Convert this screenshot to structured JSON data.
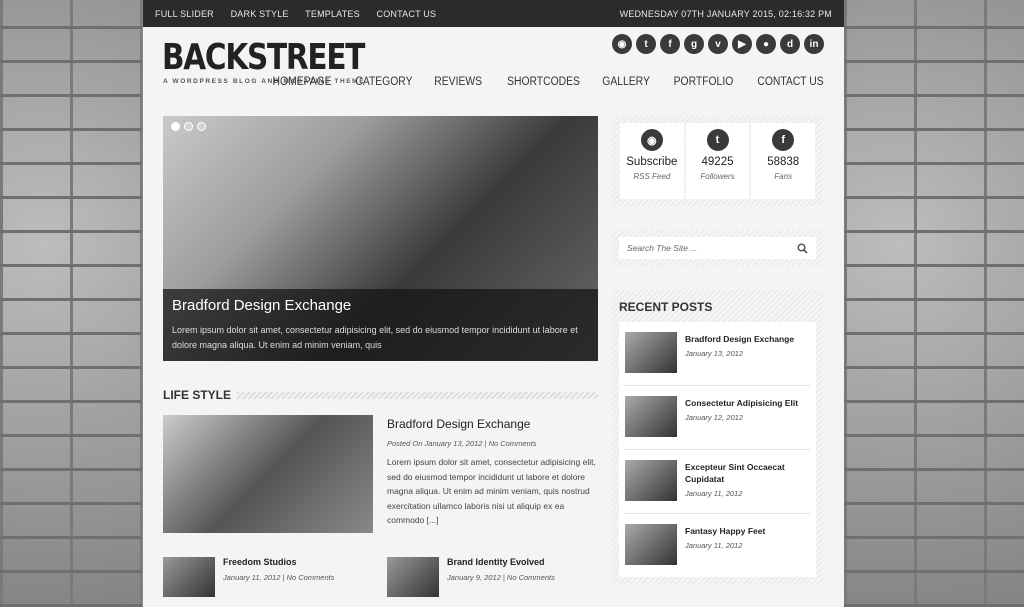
{
  "topbar": {
    "links": [
      "FULL SLIDER",
      "DARK STYLE",
      "TEMPLATES",
      "CONTACT US"
    ],
    "datetime": "WEDNESDAY 07TH JANUARY 2015, 02:16:32 PM"
  },
  "header": {
    "logo": "BACKSTREET",
    "tagline": "A WORDPRESS BLOG AND MAGAZINE THEME",
    "social_icons": [
      "rss-icon",
      "twitter-icon",
      "facebook-icon",
      "googleplus-icon",
      "vimeo-icon",
      "youtube-icon",
      "flickr-icon",
      "digg-icon",
      "linkedin-icon"
    ],
    "nav": [
      "HOMEPAGE",
      "CATEGORY",
      "REVIEWS",
      "SHORTCODES",
      "GALLERY",
      "PORTFOLIO",
      "CONTACT US"
    ]
  },
  "slider": {
    "title": "Bradford Design Exchange",
    "description": "Lorem ipsum dolor sit amet, consectetur adipisicing elit, sed do eiusmod tempor incididunt ut labore et dolore magna aliqua. Ut enim ad minim veniam, quis"
  },
  "lifestyle": {
    "heading": "LIFE STYLE",
    "featured": {
      "title": "Bradford Design Exchange",
      "meta": "Posted On January 13, 2012 | No Comments",
      "excerpt": "Lorem ipsum dolor sit amet, consectetur adipisicing elit, sed do eiusmod tempor incididunt ut labore et dolore magna aliqua. Ut enim ad minim veniam, quis nostrud exercitation ullamco laboris nisi ut aliquip ex ea commodo [...]"
    },
    "small_posts": [
      {
        "title": "Freedom Studios",
        "meta": "January 11, 2012 | No Comments"
      },
      {
        "title": "Brand Identity Evolved",
        "meta": "January 9, 2012 | No Comments"
      }
    ]
  },
  "counters": [
    {
      "icon": "rss-icon",
      "value": "Subscribe",
      "label": "RSS Feed"
    },
    {
      "icon": "twitter-icon",
      "value": "49225",
      "label": "Followers"
    },
    {
      "icon": "facebook-icon",
      "value": "58838",
      "label": "Fans"
    }
  ],
  "search": {
    "placeholder": "Search The Site ..."
  },
  "recent_posts": {
    "heading": "RECENT POSTS",
    "items": [
      {
        "title": "Bradford Design Exchange",
        "date": "January 13, 2012"
      },
      {
        "title": "Consectetur Adipisicing Elit",
        "date": "January 12, 2012"
      },
      {
        "title": "Excepteur Sint Occaecat Cupidatat",
        "date": "January 11, 2012"
      },
      {
        "title": "Fantasy Happy Feet",
        "date": "January 11, 2012"
      }
    ]
  }
}
